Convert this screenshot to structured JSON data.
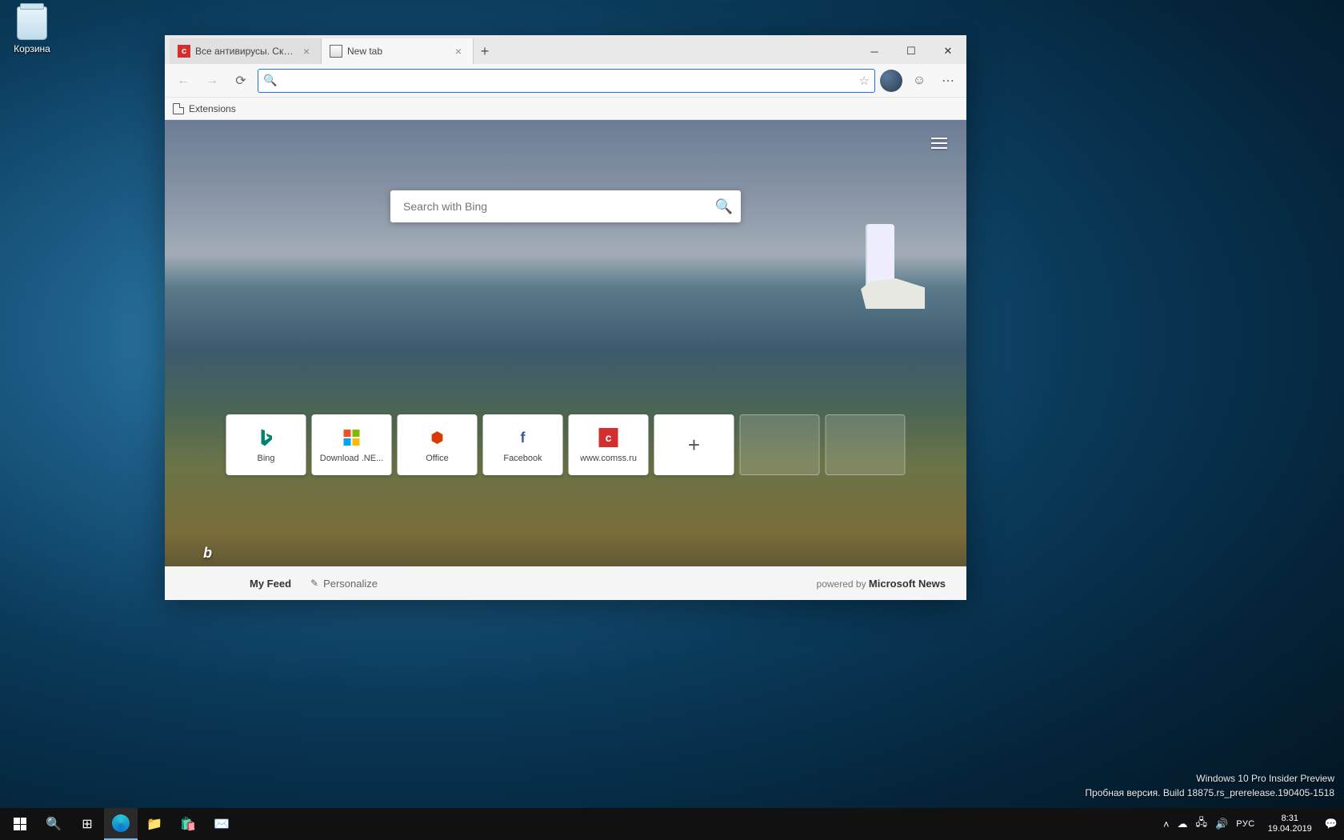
{
  "desktop": {
    "recycle_bin": "Корзина"
  },
  "window": {
    "tabs": [
      {
        "title": "Все антивирусы. Скачать беспл..."
      },
      {
        "title": "New tab"
      }
    ],
    "toolbar": {
      "address_value": "",
      "favorites": {
        "extensions": "Extensions"
      }
    }
  },
  "newtab": {
    "search_placeholder": "Search with Bing",
    "tiles": [
      {
        "label": "Bing"
      },
      {
        "label": "Download .NE..."
      },
      {
        "label": "Office"
      },
      {
        "label": "Facebook"
      },
      {
        "label": "www.comss.ru"
      }
    ],
    "bing_logo": "b",
    "footer": {
      "feed": "My Feed",
      "personalize": "Personalize",
      "powered_prefix": "powered by ",
      "powered_brand": "Microsoft News"
    }
  },
  "watermark": {
    "line1": "Windows 10 Pro Insider Preview",
    "line2": "Пробная версия. Build 18875.rs_prerelease.190405-1518"
  },
  "taskbar": {
    "lang": "РУС",
    "time": "8:31",
    "date": "19.04.2019"
  }
}
